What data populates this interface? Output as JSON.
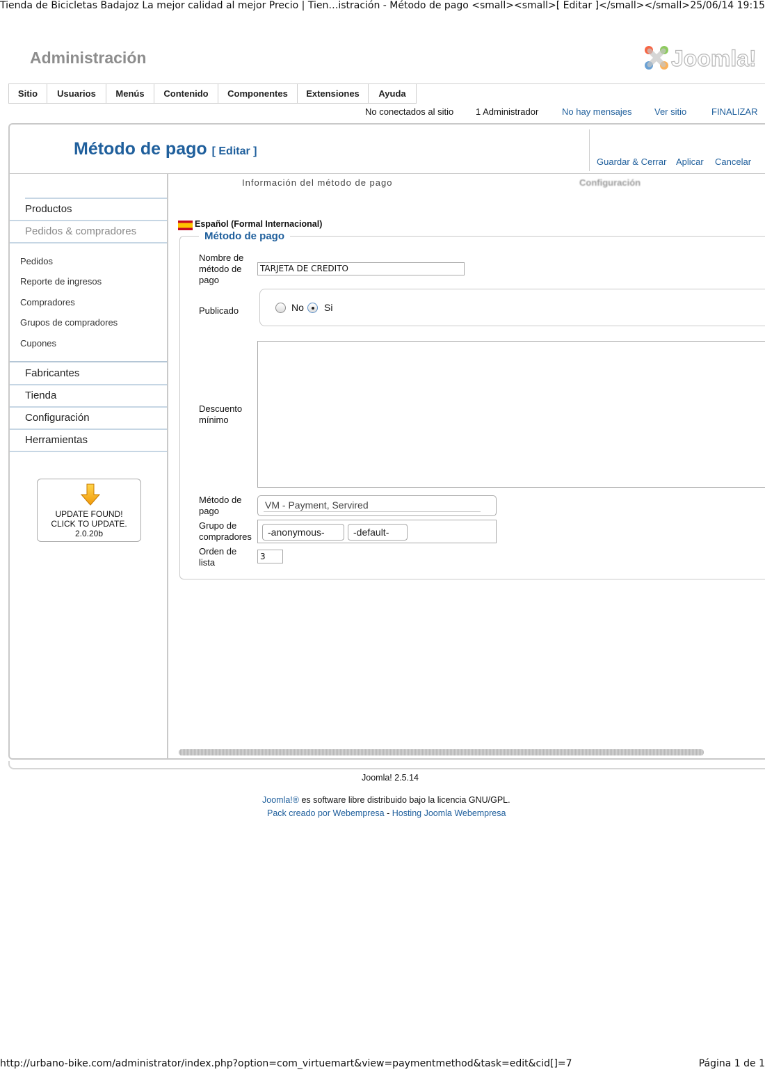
{
  "print": {
    "page_title": "Tienda de Bicicletas Badajoz La mejor calidad al mejor Precio | Tien…istración - Método de pago <small><small>[ Editar ]</small></small>",
    "datetime": "25/06/14 19:15",
    "url": "http://urbano-bike.com/administrator/index.php?option=com_virtuemart&view=paymentmethod&task=edit&cid[]=7",
    "page_number": "Página 1 de 1"
  },
  "header": {
    "admin_title": "Administración",
    "logo_text": "Joomla!"
  },
  "menu": [
    "Sitio",
    "Usuarios",
    "Menús",
    "Contenido",
    "Componentes",
    "Extensiones",
    "Ayuda"
  ],
  "status": {
    "not_connected": "No conectados al sitio",
    "admins": "1 Administrador",
    "messages": "No hay mensajes",
    "view_site": "Ver sitio",
    "logout": "FINALIZAR"
  },
  "page": {
    "title": "Método de pago",
    "subtitle": "[ Editar ]"
  },
  "toolbar": {
    "save_close": "Guardar & Cerrar",
    "apply": "Aplicar",
    "cancel": "Cancelar"
  },
  "tabs": {
    "info": "Información del método de pago",
    "config": "Configuración"
  },
  "sidebar": {
    "products": "Productos",
    "orders_buyers": "Pedidos & compradores",
    "links": [
      "Pedidos",
      "Reporte de ingresos",
      "Compradores",
      "Grupos de compradores",
      "Cupones"
    ],
    "manufacturers": "Fabricantes",
    "shop": "Tienda",
    "configuration": "Configuración",
    "tools": "Herramientas",
    "update_line1": "UPDATE FOUND!",
    "update_line2": "CLICK TO UPDATE.",
    "update_line3": "2.0.20b"
  },
  "form": {
    "language": "Español (Formal Internacional)",
    "legend": "Método de pago",
    "name_label": "Nombre de método de pago",
    "name_value": "TARJETA DE CREDITO",
    "published_label": "Publicado",
    "published_no": "No",
    "published_yes": "Si",
    "published_selected": "Si",
    "discount_label": "Descuento mínimo",
    "method_label": "Método de pago",
    "method_value": "VM - Payment, Servired",
    "group_label": "Grupo de compradores",
    "groups": [
      "-anonymous-",
      "-default-"
    ],
    "order_label": "Orden de lista",
    "order_value": "3"
  },
  "footer": {
    "version": "Joomla! 2.5.14",
    "license_link": "Joomla!®",
    "license_text": " es software libre distribuido bajo la licencia GNU/GPL.",
    "pack_link": "Pack creado por Webempresa",
    "separator": " - ",
    "hosting_link": "Hosting Joomla Webempresa"
  },
  "colors": {
    "link": "#1f5f9c",
    "admin_title": "#8d8d8d",
    "border": "#c9c9c9"
  }
}
